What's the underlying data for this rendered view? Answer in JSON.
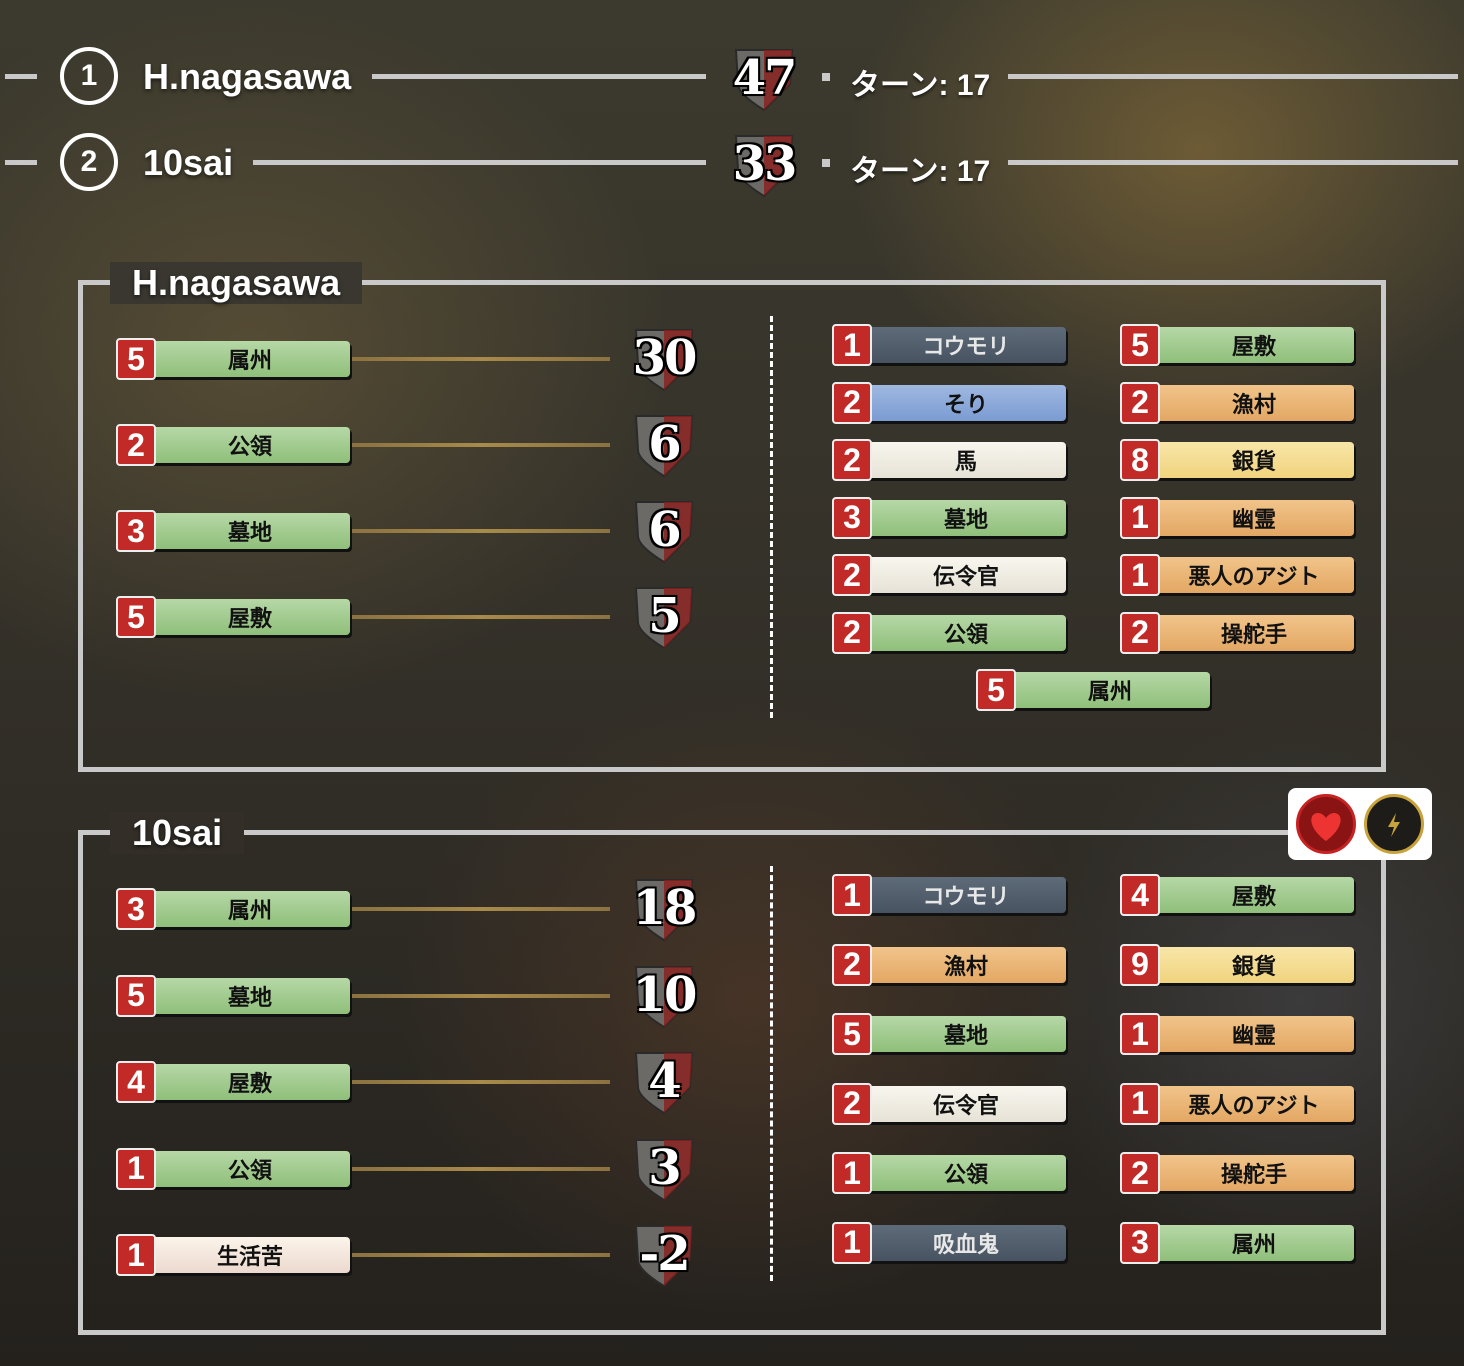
{
  "header": {
    "players": [
      {
        "rank": "1",
        "name": "H.nagasawa",
        "score": "47",
        "turn": "ターン: 17"
      },
      {
        "rank": "2",
        "name": "10sai",
        "score": "33",
        "turn": "ターン: 17"
      }
    ]
  },
  "panels": [
    {
      "title": "H.nagasawa",
      "breakdown": [
        {
          "count": "5",
          "label": "属州",
          "color": "green",
          "points": "30"
        },
        {
          "count": "2",
          "label": "公領",
          "color": "green",
          "points": "6"
        },
        {
          "count": "3",
          "label": "墓地",
          "color": "green",
          "points": "6"
        },
        {
          "count": "5",
          "label": "屋敷",
          "color": "green",
          "points": "5"
        }
      ],
      "deck": [
        {
          "count": "1",
          "label": "コウモリ",
          "color": "gray"
        },
        {
          "count": "5",
          "label": "屋敷",
          "color": "green"
        },
        {
          "count": "2",
          "label": "そり",
          "color": "blue"
        },
        {
          "count": "2",
          "label": "漁村",
          "color": "orange"
        },
        {
          "count": "2",
          "label": "馬",
          "color": "white"
        },
        {
          "count": "8",
          "label": "銀貨",
          "color": "yellow"
        },
        {
          "count": "3",
          "label": "墓地",
          "color": "green"
        },
        {
          "count": "1",
          "label": "幽霊",
          "color": "orange"
        },
        {
          "count": "2",
          "label": "伝令官",
          "color": "white"
        },
        {
          "count": "1",
          "label": "悪人のアジト",
          "color": "orange"
        },
        {
          "count": "2",
          "label": "公領",
          "color": "green"
        },
        {
          "count": "2",
          "label": "操舵手",
          "color": "orange"
        },
        {
          "count": "5",
          "label": "属州",
          "color": "green"
        }
      ]
    },
    {
      "title": "10sai",
      "breakdown": [
        {
          "count": "3",
          "label": "属州",
          "color": "green",
          "points": "18"
        },
        {
          "count": "5",
          "label": "墓地",
          "color": "green",
          "points": "10"
        },
        {
          "count": "4",
          "label": "屋敷",
          "color": "green",
          "points": "4"
        },
        {
          "count": "1",
          "label": "公領",
          "color": "green",
          "points": "3"
        },
        {
          "count": "1",
          "label": "生活苦",
          "color": "cream",
          "points": "-2"
        }
      ],
      "deck": [
        {
          "count": "1",
          "label": "コウモリ",
          "color": "gray"
        },
        {
          "count": "4",
          "label": "屋敷",
          "color": "green"
        },
        {
          "count": "2",
          "label": "漁村",
          "color": "orange"
        },
        {
          "count": "9",
          "label": "銀貨",
          "color": "yellow"
        },
        {
          "count": "5",
          "label": "墓地",
          "color": "green"
        },
        {
          "count": "1",
          "label": "幽霊",
          "color": "orange"
        },
        {
          "count": "2",
          "label": "伝令官",
          "color": "white"
        },
        {
          "count": "1",
          "label": "悪人のアジト",
          "color": "orange"
        },
        {
          "count": "1",
          "label": "公領",
          "color": "green"
        },
        {
          "count": "2",
          "label": "操舵手",
          "color": "orange"
        },
        {
          "count": "1",
          "label": "吸血鬼",
          "color": "gray"
        },
        {
          "count": "3",
          "label": "属州",
          "color": "green"
        }
      ]
    }
  ],
  "icons": {
    "heart": "heart-icon",
    "bolt": "lightning-icon"
  },
  "colors": {
    "count_badge": "#c12a26",
    "frame": "#c9c9c9",
    "gold_line": "#a88a4a"
  }
}
